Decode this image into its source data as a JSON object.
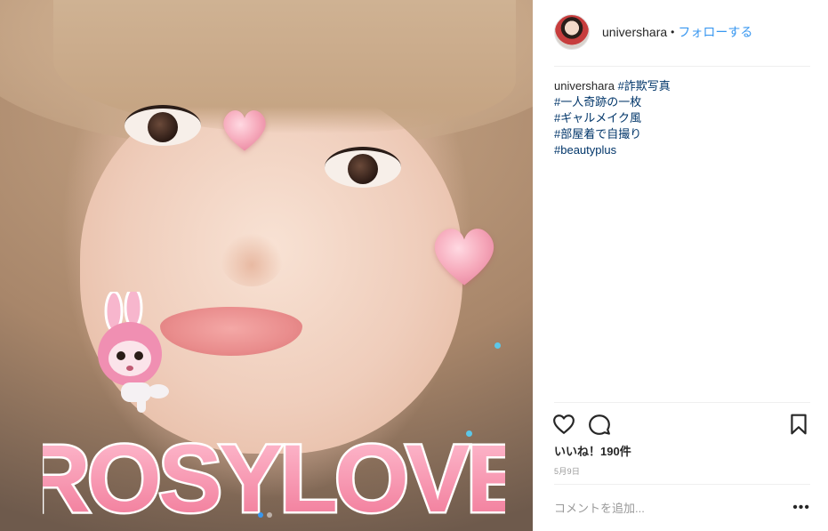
{
  "header": {
    "username": "univershara",
    "separator": "•",
    "follow_label": "フォローする"
  },
  "caption": {
    "username": "univershara",
    "first_tag": "#詐欺写真",
    "tags": [
      "#一人奇跡の一枚",
      "#ギャルメイク風",
      "#部屋着で自撮り",
      "#beautyplus"
    ]
  },
  "photo": {
    "sticker_text": "ROSYLOVE",
    "carousel_pages": 2,
    "carousel_active": 1
  },
  "actions": {
    "like_icon": "heart-icon",
    "comment_icon": "comment-icon",
    "save_icon": "bookmark-icon"
  },
  "likes_text": "いいね！190件",
  "date_text": "5月9日",
  "comment": {
    "placeholder": "コメントを追加...",
    "more_label": "•••"
  },
  "colors": {
    "link": "#3897f0",
    "hashtag": "#003569"
  }
}
